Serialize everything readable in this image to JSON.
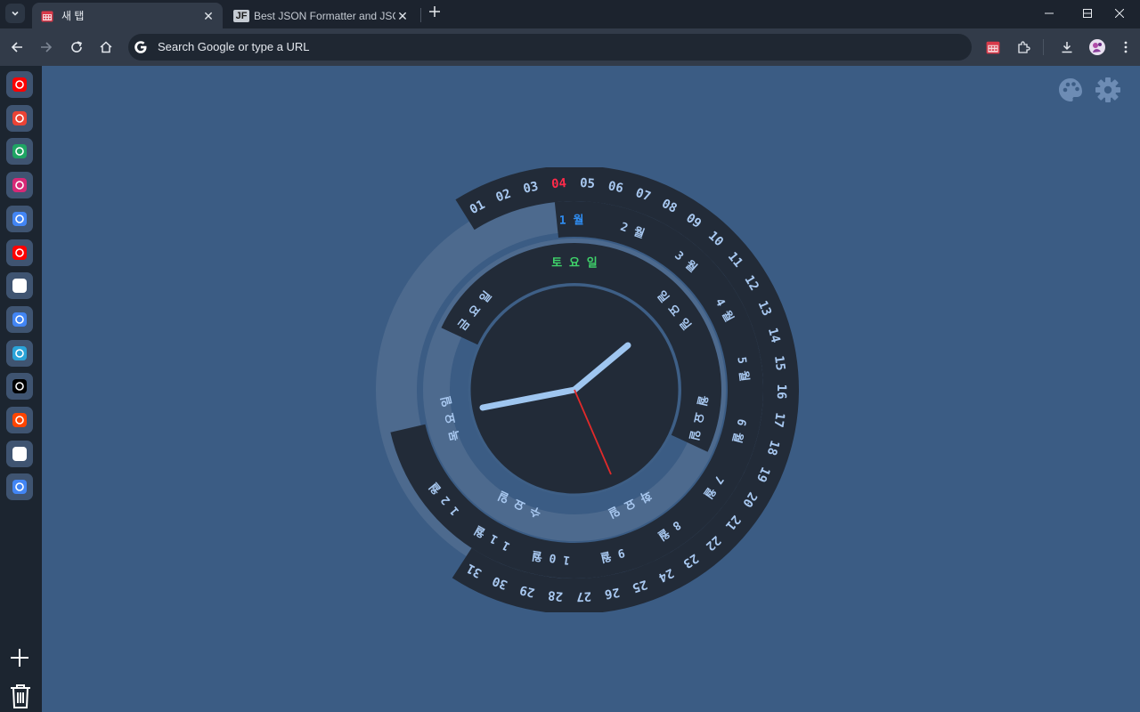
{
  "tabs": [
    {
      "title": "새 탭",
      "close": "✕",
      "active": true
    },
    {
      "title": "Best JSON Formatter and JSON",
      "close": "✕",
      "icon_text": "JF",
      "active": false
    }
  ],
  "omnibox": {
    "placeholder": "Search Google or type a URL"
  },
  "sidebar": {
    "apps": [
      {
        "name": "youtube-icon",
        "color": "#ff0000"
      },
      {
        "name": "gmail-icon",
        "color": "#ea4335"
      },
      {
        "name": "google-drive-icon",
        "color": "#1fa463"
      },
      {
        "name": "instagram-icon",
        "color": "#d62976"
      },
      {
        "name": "chrome-icon",
        "color": "#4285f4"
      },
      {
        "name": "youtube-music-icon",
        "color": "#ff0000"
      },
      {
        "name": "chatgpt-icon",
        "color": "#ffffff"
      },
      {
        "name": "chrome-icon",
        "color": "#4285f4"
      },
      {
        "name": "telegram-icon",
        "color": "#2aa3d8"
      },
      {
        "name": "x-icon",
        "color": "#000000"
      },
      {
        "name": "reddit-icon",
        "color": "#ff4500"
      },
      {
        "name": "amazon-icon",
        "color": "#ffffff"
      },
      {
        "name": "google-translate-icon",
        "color": "#4285f4"
      }
    ]
  },
  "clock": {
    "days": [
      "01",
      "02",
      "03",
      "04",
      "05",
      "06",
      "07",
      "08",
      "09",
      "10",
      "11",
      "12",
      "13",
      "14",
      "15",
      "16",
      "17",
      "18",
      "19",
      "20",
      "21",
      "22",
      "23",
      "24",
      "25",
      "26",
      "27",
      "28",
      "29",
      "30",
      "31"
    ],
    "current_day": "04",
    "months": [
      "1 월",
      "2 월",
      "3 월",
      "4 월",
      "5 월",
      "6 월",
      "7 월",
      "8 월",
      "9 월",
      "1 0 월",
      "1 1 월",
      "1 2 월"
    ],
    "current_month": "1 월",
    "weekdays": [
      "토 요 일",
      "일 요 일",
      "월 요 일",
      "화 요 일",
      "수 요 일",
      "목 요 일",
      "금 요 일"
    ],
    "current_weekday": "토 요 일",
    "colors": {
      "day_text": "#a8c8f0",
      "current_day": "#ff2a4a",
      "current_month": "#2f8cf0",
      "current_weekday": "#3fd26a",
      "ring_dark": "#222b38",
      "ring_track": "#4d6a8e",
      "hands": "#9fc6f0",
      "second_hand": "#e12a2a"
    }
  }
}
